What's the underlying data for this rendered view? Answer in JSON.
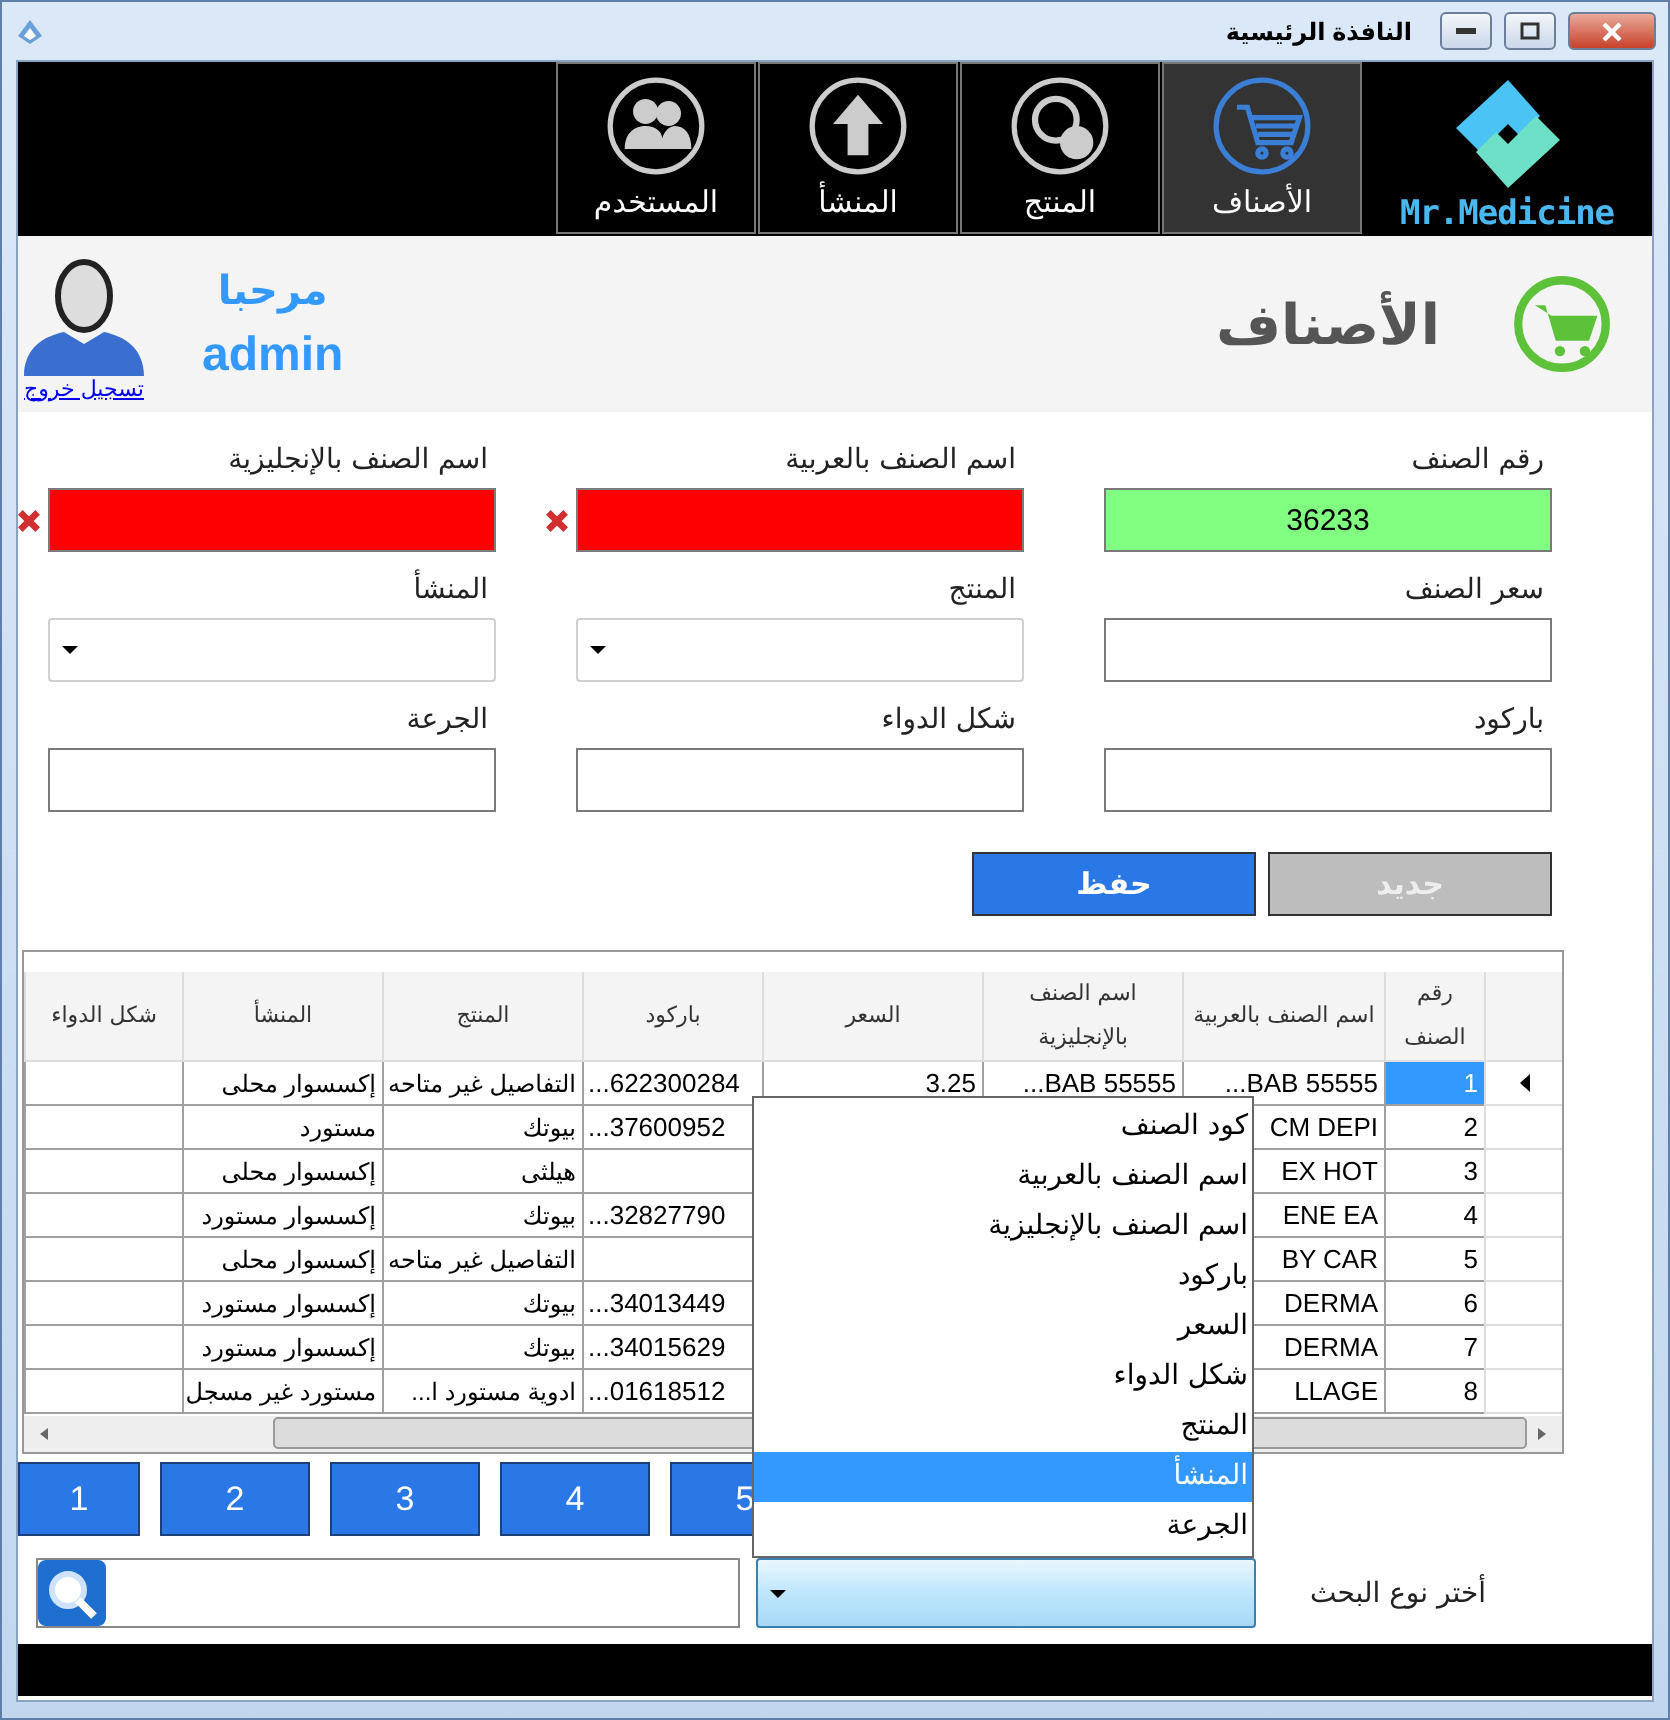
{
  "window": {
    "title": "النافذة الرئيسية"
  },
  "logo": {
    "text": "Mr.Medicine"
  },
  "nav": [
    {
      "label": "الأصناف",
      "kind": "cart",
      "selected": true
    },
    {
      "label": "المنتج",
      "kind": "circles",
      "selected": false
    },
    {
      "label": "المنشأ",
      "kind": "upload",
      "selected": false
    },
    {
      "label": "المستخدم",
      "kind": "users",
      "selected": false
    }
  ],
  "user": {
    "greeting": "مرحبا",
    "name": "admin",
    "logout": "تسجيل خروج"
  },
  "page": {
    "title": "الأصناف"
  },
  "form": {
    "fields": [
      {
        "label": "رقم الصنف",
        "kind": "text",
        "value": "36233",
        "valid": true,
        "invalid": false
      },
      {
        "label": "اسم الصنف بالعربية",
        "kind": "text",
        "valid": false,
        "invalid": true
      },
      {
        "label": "اسم الصنف بالإنجليزية",
        "kind": "text",
        "valid": false,
        "invalid": true
      },
      {
        "label": "سعر الصنف",
        "kind": "text",
        "valid": false,
        "invalid": false
      },
      {
        "label": "المنتج",
        "kind": "select"
      },
      {
        "label": "المنشأ",
        "kind": "select"
      },
      {
        "label": "باركود",
        "kind": "text",
        "valid": false,
        "invalid": false
      },
      {
        "label": "شكل الدواء",
        "kind": "text",
        "valid": false,
        "invalid": false
      },
      {
        "label": "الجرعة",
        "kind": "text",
        "valid": false,
        "invalid": false
      }
    ],
    "buttons": [
      {
        "label": "جديد",
        "disabled": true
      },
      {
        "label": "حفظ",
        "disabled": false
      }
    ]
  },
  "table": {
    "columns": [
      "رقم الصنف",
      "اسم الصنف بالعربية",
      "اسم الصنف بالإنجليزية",
      "السعر",
      "باركود",
      "المنتج",
      "المنشأ",
      "شكل الدواء"
    ],
    "rows": [
      {
        "selected": true,
        "number": "1",
        "name_ar": "...BAB 55555",
        "name_en": "...BAB 55555",
        "price": "3.25",
        "barcode": "...622300284",
        "producer": "التفاصيل غير متاحه",
        "origin": "إكسسوار محلى"
      },
      {
        "selected": false,
        "number": "2",
        "name_ar": "CM DEPI",
        "barcode": "...37600952",
        "producer": "بيوتك",
        "origin": "مستورد"
      },
      {
        "selected": false,
        "number": "3",
        "name_ar": "EX HOT",
        "producer": "هيلثى",
        "origin": "إكسسوار محلى"
      },
      {
        "selected": false,
        "number": "4",
        "name_ar": "ENE EA",
        "barcode": "...32827790",
        "producer": "بيوتك",
        "origin": "إكسسوار مستورد"
      },
      {
        "selected": false,
        "number": "5",
        "name_ar": "BY CAR",
        "producer": "التفاصيل غير متاحه",
        "origin": "إكسسوار محلى"
      },
      {
        "selected": false,
        "number": "6",
        "name_ar": "DERMA",
        "barcode": "...34013449",
        "producer": "بيوتك",
        "origin": "إكسسوار مستورد"
      },
      {
        "selected": false,
        "number": "7",
        "name_ar": "DERMA",
        "barcode": "...34015629",
        "producer": "بيوتك",
        "origin": "إكسسوار مستورد"
      },
      {
        "selected": false,
        "number": "8",
        "name_ar": "LLAGE",
        "barcode": "...01618512",
        "producer": "ادوية مستورد ا...",
        "origin": "مستورد غير مسجل"
      }
    ]
  },
  "pages": [
    "5",
    "4",
    "3",
    "2",
    "1"
  ],
  "search": {
    "label": "أختر نوع البحث",
    "options": [
      {
        "label": "كود الصنف",
        "selected": false
      },
      {
        "label": "اسم الصنف بالعربية",
        "selected": false
      },
      {
        "label": "اسم الصنف بالإنجليزية",
        "selected": false
      },
      {
        "label": "باركود",
        "selected": false
      },
      {
        "label": "السعر",
        "selected": false
      },
      {
        "label": "شكل الدواء",
        "selected": false
      },
      {
        "label": "المنتج",
        "selected": false
      },
      {
        "label": "المنشأ",
        "selected": true
      },
      {
        "label": "الجرعة",
        "selected": false
      }
    ]
  }
}
